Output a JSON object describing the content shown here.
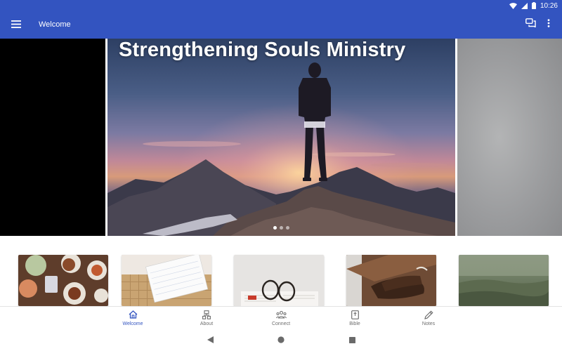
{
  "status_bar": {
    "time": "10:26",
    "icons": [
      "wifi-icon",
      "signal-icon",
      "battery-icon"
    ]
  },
  "app_bar": {
    "title": "Welcome",
    "icons": [
      "menu-icon",
      "chat-icon",
      "more-vert-icon"
    ],
    "color": "#3354c0"
  },
  "carousel": {
    "title": "Strengthening Souls Ministry",
    "slides": 3,
    "active_slide": 1
  },
  "cards": [
    {
      "name": "food-table"
    },
    {
      "name": "notebook"
    },
    {
      "name": "glasses-book"
    },
    {
      "name": "praying-hands"
    },
    {
      "name": "grass-field"
    }
  ],
  "bottom_nav": {
    "items": [
      {
        "label": "Welcome",
        "icon": "home-icon",
        "active": true
      },
      {
        "label": "About",
        "icon": "org-chart-icon",
        "active": false
      },
      {
        "label": "Connect",
        "icon": "people-icon",
        "active": false
      },
      {
        "label": "Bible",
        "icon": "book-icon",
        "active": false
      },
      {
        "label": "Notes",
        "icon": "pencil-icon",
        "active": false
      }
    ],
    "active_color": "#3354c0",
    "inactive_color": "#6e6e6e"
  },
  "system_nav": {
    "icons": [
      "back-icon",
      "home-circle-icon",
      "recents-icon"
    ]
  }
}
